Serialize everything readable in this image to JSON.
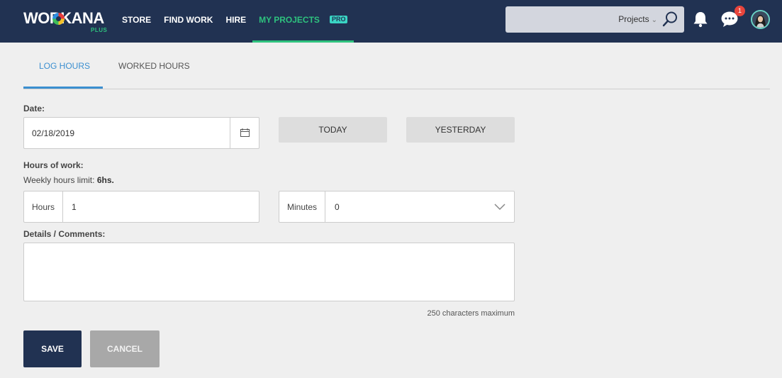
{
  "brand": {
    "logo_text": "WORKANA",
    "logo_sub": "PLUS",
    "accent_green": "#2ec27e",
    "navy": "#213252",
    "blue": "#3b8fd0"
  },
  "nav": {
    "items": [
      {
        "label": "STORE"
      },
      {
        "label": "FIND WORK"
      },
      {
        "label": "HIRE"
      },
      {
        "label": "MY PROJECTS"
      }
    ],
    "pro_badge": "PRO"
  },
  "search": {
    "scope": "Projects",
    "icon": "search-icon"
  },
  "header_icons": {
    "bell": "bell-icon",
    "chat": "chat-icon",
    "chat_badge": "1",
    "avatar": "avatar"
  },
  "tabs": [
    {
      "label": "LOG HOURS",
      "active": true
    },
    {
      "label": "WORKED HOURS",
      "active": false
    }
  ],
  "form": {
    "date_label": "Date:",
    "date_value": "02/18/2019",
    "calendar_icon": "calendar-icon",
    "today_label": "TODAY",
    "yesterday_label": "YESTERDAY",
    "hours_label": "Hours of work:",
    "weekly_limit_text": "Weekly hours limit:",
    "weekly_limit_value": "6hs.",
    "hours_addon": "Hours",
    "hours_value": "1",
    "minutes_addon": "Minutes",
    "minutes_value": "0",
    "details_label": "Details / Comments:",
    "details_value": "",
    "char_limit": "250 characters maximum",
    "save_label": "SAVE",
    "cancel_label": "CANCEL"
  }
}
